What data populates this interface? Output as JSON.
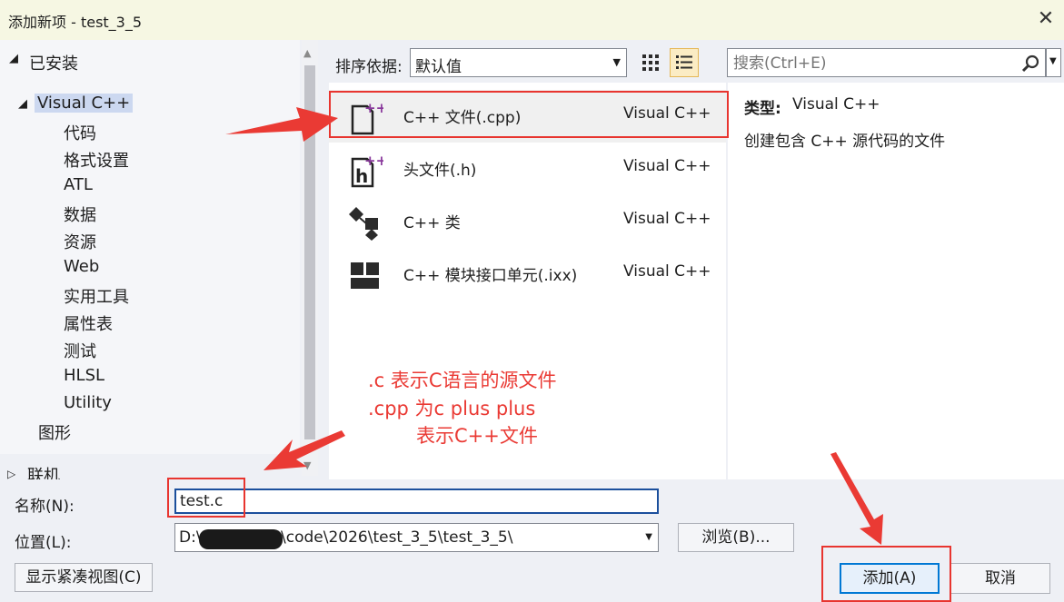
{
  "window": {
    "title": "添加新项 - test_3_5",
    "close_glyph": "✕"
  },
  "tree": {
    "installed": "已安装",
    "visual_cpp": "Visual C++",
    "children": [
      "代码",
      "格式设置",
      "ATL",
      "数据",
      "资源",
      "Web",
      "实用工具",
      "属性表",
      "测试",
      "HLSL",
      "Utility"
    ],
    "graphics": "图形",
    "online": "联机"
  },
  "sort": {
    "label": "排序依据:",
    "value": "默认值"
  },
  "search": {
    "placeholder": "搜索(Ctrl+E)"
  },
  "templates": [
    {
      "name": "C++ 文件(.cpp)",
      "type": "Visual C++",
      "icon": "cpp-file-icon",
      "selected": true
    },
    {
      "name": "头文件(.h)",
      "type": "Visual C++",
      "icon": "header-file-icon",
      "selected": false
    },
    {
      "name": "C++ 类",
      "type": "Visual C++",
      "icon": "class-icon",
      "selected": false
    },
    {
      "name": "C++ 模块接口单元(.ixx)",
      "type": "Visual C++",
      "icon": "module-icon",
      "selected": false
    }
  ],
  "details": {
    "type_label": "类型:",
    "type_value": "Visual C++",
    "description": "创建包含 C++ 源代码的文件"
  },
  "form": {
    "name_label": "名称(N):",
    "name_value": "test.c",
    "location_label": "位置(L):",
    "location_prefix": "D:\\",
    "location_rest": "\\code\\2026\\test_3_5\\test_3_5\\",
    "browse": "浏览(B)...",
    "compact_view": "显示紧凑视图(C)",
    "add": "添加(A)",
    "cancel": "取消"
  },
  "annotations": [
    ".c 表示C语言的源文件",
    ".cpp 为c plus plus",
    "表示C++文件"
  ],
  "colors": {
    "accent": "#0078d4",
    "annotation": "#e8352f",
    "selected_row": "#f0f0f0"
  }
}
